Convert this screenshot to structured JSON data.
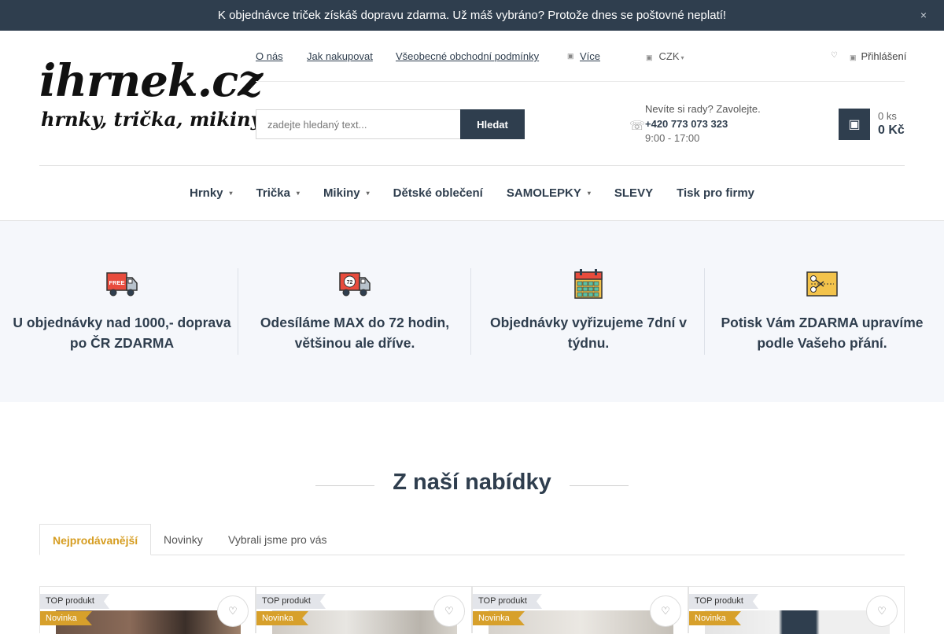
{
  "announcement": {
    "icon_left": "gift-icon",
    "text": "K objednávce triček získáš dopravu zdarma.  Už máš vybráno? Protože dnes se poštovné neplatí!",
    "close_label": "×"
  },
  "logo": {
    "line1": "ihrnek.cz",
    "line2": "hrnky, trička, mikiny"
  },
  "toplinks": {
    "about": "O nás",
    "how_to_buy": "Jak nakupovat",
    "terms": "Všeobecné obchodní podmínky",
    "more": "Více",
    "currency": "CZK",
    "login": "Přihlášení"
  },
  "search": {
    "placeholder": "zadejte hledaný text...",
    "button": "Hledat"
  },
  "contact": {
    "line1": "Nevíte si rady? Zavolejte.",
    "phone": "+420 773 073 323",
    "hours": "9:00 - 17:00"
  },
  "cart": {
    "qty": "0 ks",
    "price": "0 Kč"
  },
  "nav": [
    {
      "label": "Hrnky",
      "dropdown": true
    },
    {
      "label": "Trička",
      "dropdown": true
    },
    {
      "label": "Mikiny",
      "dropdown": true
    },
    {
      "label": "Dětské oblečení",
      "dropdown": false
    },
    {
      "label": "SAMOLEPKY",
      "dropdown": true
    },
    {
      "label": "SLEVY",
      "dropdown": false
    },
    {
      "label": "Tisk pro firmy",
      "dropdown": false
    }
  ],
  "benefits": [
    {
      "icon": "free-delivery-truck-icon",
      "text": "U objednávky nad 1000,- doprava po ČR ZDARMA"
    },
    {
      "icon": "72-hour-truck-icon",
      "text": "Odesíláme MAX do 72 hodin, většinou ale dříve."
    },
    {
      "icon": "calendar-icon",
      "text": "Objednávky vyřizujeme 7dní v týdnu."
    },
    {
      "icon": "coupon-scissors-icon",
      "text": "Potisk Vám ZDARMA upravíme podle Vašeho přání."
    }
  ],
  "offer": {
    "title": "Z naší nabídky",
    "tabs": [
      "Nejprodávanější",
      "Novinky",
      "Vybrali jsme pro vás"
    ],
    "active_tab": "Nejprodávanější"
  },
  "products": [
    {
      "flag_top": "TOP produkt",
      "flag_new": "Novinka"
    },
    {
      "flag_top": "TOP produkt",
      "flag_new": "Novinka"
    },
    {
      "flag_top": "TOP produkt",
      "flag_new": "Novinka"
    },
    {
      "flag_top": "TOP produkt",
      "flag_new": "Novinka"
    }
  ],
  "colors": {
    "primary": "#2f3e4e",
    "accent": "#d69d21",
    "benefits_bg": "#f5f7fb"
  }
}
